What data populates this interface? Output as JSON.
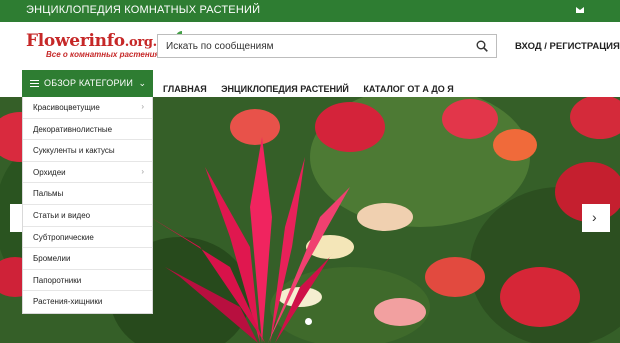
{
  "topbar": {
    "tagline": "ЭНЦИКЛОПЕДИЯ КОМНАТНЫХ РАСТЕНИЙ",
    "icon": "mail-icon"
  },
  "logo": {
    "name": "Flowerinfo",
    "domain": ".org.ua",
    "subtitle": "Все о комнатных растениях"
  },
  "search": {
    "placeholder": "Искать по сообщениям",
    "icon": "search-icon"
  },
  "auth": {
    "label": "ВХОД / РЕГИСТРАЦИЯ"
  },
  "categories": {
    "button_label": "ОБЗОР КАТЕГОРИИ",
    "items": [
      {
        "label": "Красивоцветущие",
        "arrow": "›"
      },
      {
        "label": "Декоративнолистные"
      },
      {
        "label": "Суккуленты и кактусы"
      },
      {
        "label": "Орхидеи",
        "arrow": "›"
      },
      {
        "label": "Пальмы"
      },
      {
        "label": "Статьи и видео"
      },
      {
        "label": "Субтропические"
      },
      {
        "label": "Бромелии"
      },
      {
        "label": "Папоротники"
      },
      {
        "label": "Растения-хищники"
      }
    ]
  },
  "nav": {
    "links": [
      {
        "label": "ГЛАВНАЯ",
        "active": true
      },
      {
        "label": "ЭНЦИКЛОПЕДИЯ РАСТЕНИЙ"
      },
      {
        "label": "КАТАЛОГ ОТ А ДО Я"
      }
    ]
  },
  "slider": {
    "next": "›",
    "active_slide": 1
  },
  "colors": {
    "brand_green": "#2e7d32",
    "logo_red": "#c62828"
  }
}
